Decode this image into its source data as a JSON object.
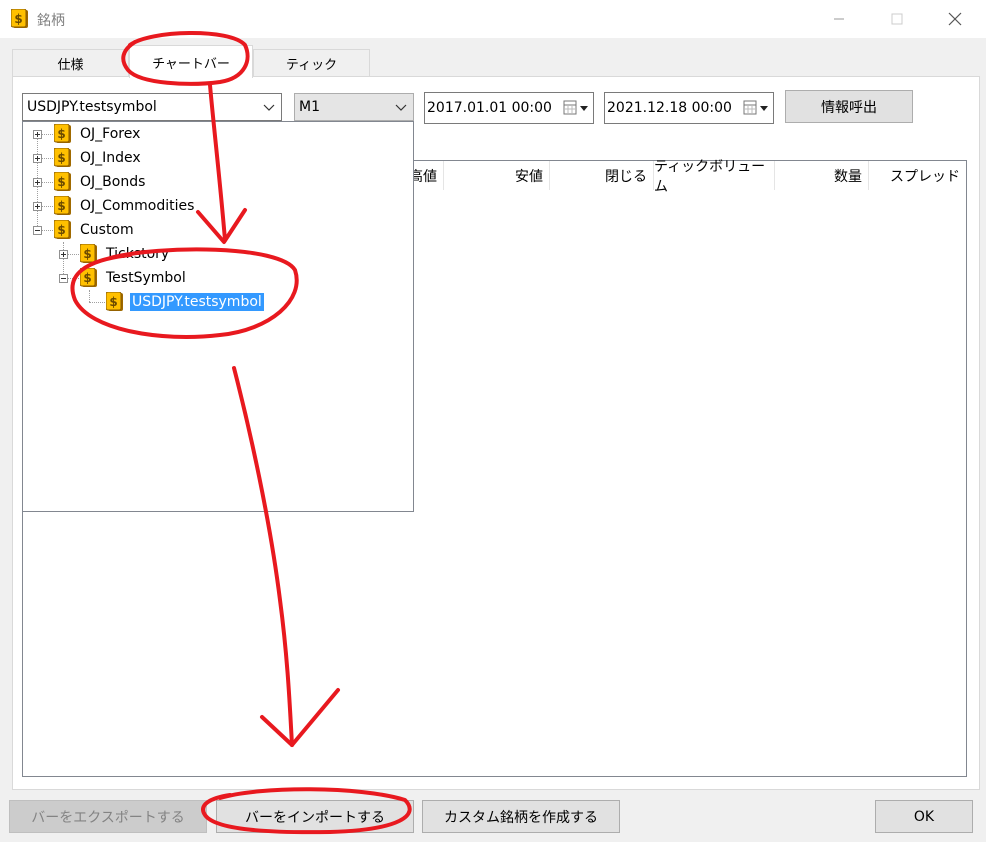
{
  "window": {
    "title": "銘柄"
  },
  "tabs": [
    {
      "label": "仕様",
      "active": false
    },
    {
      "label": "チャートバー",
      "active": true
    },
    {
      "label": "ティック",
      "active": false
    }
  ],
  "toolbar": {
    "symbol_value": "USDJPY.testsymbol",
    "timeframe_value": "M1",
    "date_from": "2017.01.01 00:00",
    "date_to": "2021.12.18 00:00",
    "request_label": "情報呼出"
  },
  "tree": {
    "nodes": [
      {
        "label": "OJ_Forex"
      },
      {
        "label": "OJ_Index"
      },
      {
        "label": "OJ_Bonds"
      },
      {
        "label": "OJ_Commodities"
      },
      {
        "label": "Custom"
      },
      {
        "label": "Tickstory"
      },
      {
        "label": "TestSymbol"
      },
      {
        "label": "USDJPY.testsymbol"
      }
    ]
  },
  "table": {
    "columns": [
      "高値",
      "安値",
      "閉じる",
      "ティックボリューム",
      "数量",
      "スプレッド"
    ]
  },
  "footer": {
    "export_label": "バーをエクスポートする",
    "import_label": "バーをインポートする",
    "create_label": "カスタム銘柄を作成する",
    "ok_label": "OK"
  },
  "colors": {
    "selection": "#3399ff",
    "annotation": "#e8191f"
  }
}
